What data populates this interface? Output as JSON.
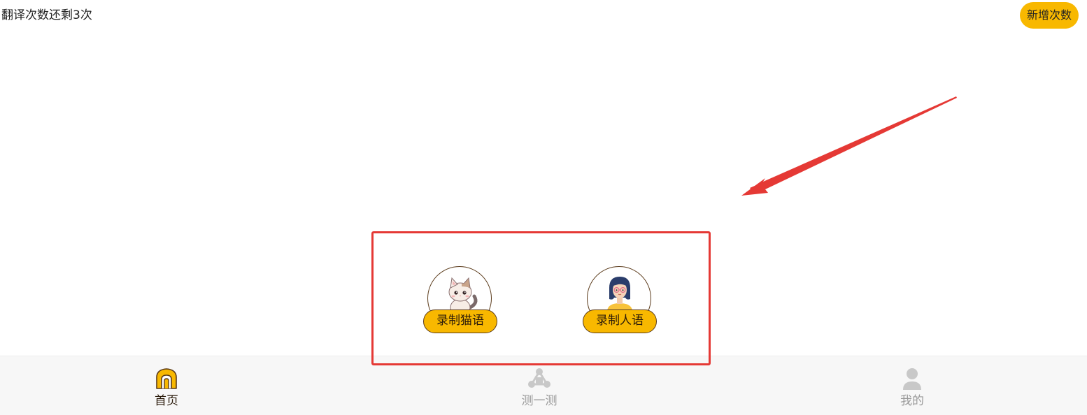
{
  "header": {
    "remaining_text": "翻译次数还剩3次",
    "add_button_label": "新增次数"
  },
  "record": {
    "cat_label": "录制猫语",
    "human_label": "录制人语"
  },
  "tabbar": {
    "tabs": [
      {
        "label": "首页",
        "icon": "home-icon",
        "active": true
      },
      {
        "label": "测一测",
        "icon": "test-icon",
        "active": false
      },
      {
        "label": "我的",
        "icon": "user-icon",
        "active": false
      }
    ]
  },
  "colors": {
    "accent": "#f8b800",
    "highlight": "#e53935",
    "inactive": "#999999"
  }
}
